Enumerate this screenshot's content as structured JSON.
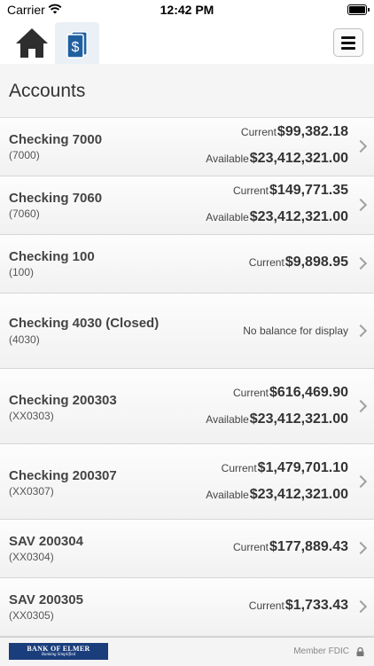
{
  "status_bar": {
    "carrier": "Carrier",
    "time": "12:42 PM"
  },
  "nav": {
    "home_icon": "home-icon",
    "accounts_icon": "dollar-document-icon",
    "menu_icon": "hamburger-menu-icon"
  },
  "page": {
    "title": "Accounts"
  },
  "accounts": [
    {
      "name": "Checking 7000",
      "number": "(7000)",
      "current_label": "Current",
      "current": "$99,382.18",
      "available_label": "Available",
      "available": "$23,412,321.00"
    },
    {
      "name": "Checking 7060",
      "number": "(7060)",
      "current_label": "Current",
      "current": "$149,771.35",
      "available_label": "Available",
      "available": "$23,412,321.00"
    },
    {
      "name": "Checking 100",
      "number": "(100)",
      "current_label": "Current",
      "current": "$9,898.95"
    },
    {
      "name": "Checking 4030 (Closed)",
      "number": "(4030)",
      "no_balance": "No balance for display"
    },
    {
      "name": "Checking 200303",
      "number": "(XX0303)",
      "current_label": "Current",
      "current": "$616,469.90",
      "available_label": "Available",
      "available": "$23,412,321.00"
    },
    {
      "name": "Checking 200307",
      "number": "(XX0307)",
      "current_label": "Current",
      "current": "$1,479,701.10",
      "available_label": "Available",
      "available": "$23,412,321.00"
    },
    {
      "name": "SAV 200304",
      "number": "(XX0304)",
      "current_label": "Current",
      "current": "$177,889.43"
    },
    {
      "name": "SAV 200305",
      "number": "(XX0305)",
      "current_label": "Current",
      "current": "$1,733.43"
    }
  ],
  "footer": {
    "logo_name": "BANK OF ELMER",
    "logo_tagline": "Banking Simplified",
    "fdic": "Member FDIC"
  }
}
